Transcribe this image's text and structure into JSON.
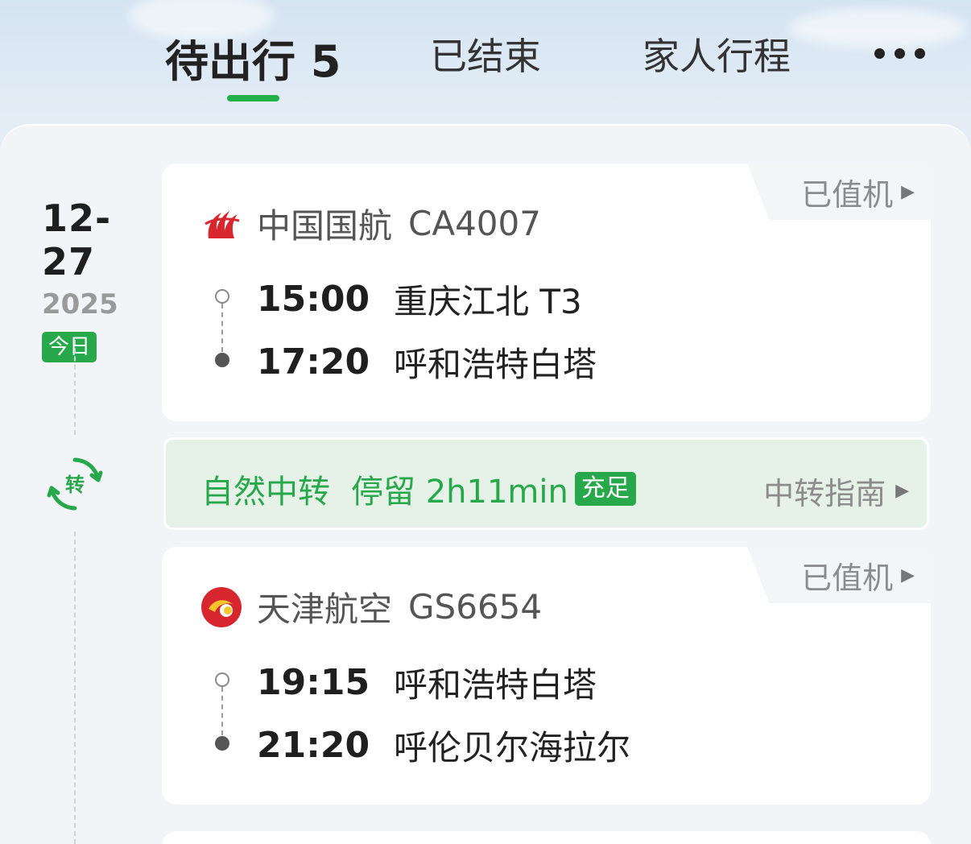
{
  "tabs": [
    {
      "label": "待出行",
      "count": "5",
      "active": true
    },
    {
      "label": "已结束",
      "active": false
    },
    {
      "label": "家人行程",
      "active": false
    }
  ],
  "more_icon": "more-dots-icon",
  "accent_color": "#27a84a",
  "trip": {
    "date": "12-27",
    "year": "2025",
    "today_badge": "今日",
    "transfer_icon_label": "转"
  },
  "flights": [
    {
      "airline": "中国国航",
      "flight_no": "CA4007",
      "logo_icon": "air-china-logo-icon",
      "checkin_status": "已值机",
      "depart_time": "15:00",
      "depart_airport": "重庆江北 T3",
      "arrive_time": "17:20",
      "arrive_airport": "呼和浩特白塔"
    },
    {
      "airline": "天津航空",
      "flight_no": "GS6654",
      "logo_icon": "tianjin-airlines-logo-icon",
      "checkin_status": "已值机",
      "depart_time": "19:15",
      "depart_airport": "呼和浩特白塔",
      "arrive_time": "21:20",
      "arrive_airport": "呼伦贝尔海拉尔"
    }
  ],
  "transfer": {
    "type": "自然中转",
    "stay": "停留 2h11min",
    "badge": "充足",
    "guide_link": "中转指南"
  }
}
